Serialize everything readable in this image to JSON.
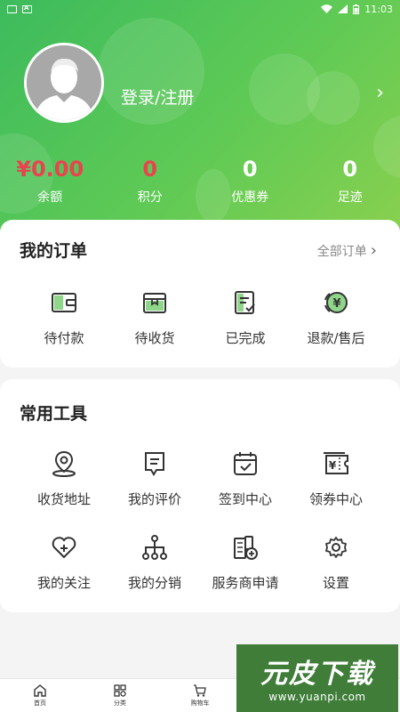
{
  "status_bar": {
    "time": "11:03"
  },
  "profile": {
    "login_text": "登录/注册"
  },
  "stats": [
    {
      "value": "¥0.00",
      "label": "余额",
      "color": "#e8444f"
    },
    {
      "value": "0",
      "label": "积分",
      "color": "#e8444f"
    },
    {
      "value": "0",
      "label": "优惠券",
      "color": "#ffffff"
    },
    {
      "value": "0",
      "label": "足迹",
      "color": "#ffffff"
    }
  ],
  "orders": {
    "title": "我的订单",
    "all_label": "全部订单",
    "items": [
      {
        "label": "待付款",
        "icon": "wallet-icon"
      },
      {
        "label": "待收货",
        "icon": "package-icon"
      },
      {
        "label": "已完成",
        "icon": "checklist-icon"
      },
      {
        "label": "退款/售后",
        "icon": "refund-icon"
      }
    ]
  },
  "tools": {
    "title": "常用工具",
    "items": [
      {
        "label": "收货地址",
        "icon": "location-pin-icon"
      },
      {
        "label": "我的评价",
        "icon": "comment-icon"
      },
      {
        "label": "签到中心",
        "icon": "calendar-check-icon"
      },
      {
        "label": "领券中心",
        "icon": "coupon-icon"
      },
      {
        "label": "我的关注",
        "icon": "heart-plus-icon"
      },
      {
        "label": "我的分销",
        "icon": "share-tree-icon"
      },
      {
        "label": "服务商申请",
        "icon": "building-add-icon"
      },
      {
        "label": "设置",
        "icon": "gear-icon"
      }
    ]
  },
  "bottom_nav": [
    {
      "label": "首页",
      "icon": "home-icon"
    },
    {
      "label": "分类",
      "icon": "category-icon"
    },
    {
      "label": "购物车",
      "icon": "cart-icon"
    },
    {
      "label": "",
      "icon": ""
    },
    {
      "label": "",
      "icon": ""
    }
  ],
  "watermark": {
    "brand": "元皮下载",
    "url": "www.yuanpi.com"
  },
  "colors": {
    "green_start": "#3dbb5d",
    "green_end": "#8ad04f",
    "price_red": "#e8444f"
  }
}
